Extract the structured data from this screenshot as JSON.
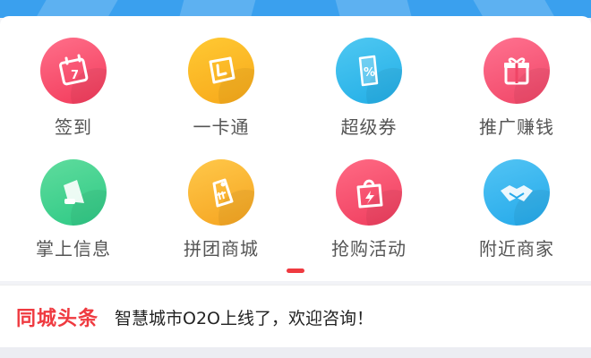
{
  "colors": {
    "accent_red": "#ef3a40",
    "banner_blue": "#3aa0ee"
  },
  "grid": {
    "items": [
      {
        "label": "签到",
        "icon": "calendar-icon",
        "color_top": "#ff6f8a",
        "color_bottom": "#f23a5a"
      },
      {
        "label": "一卡通",
        "icon": "card-icon",
        "color_top": "#ffc933",
        "color_bottom": "#f7a81a"
      },
      {
        "label": "超级券",
        "icon": "coupon-icon",
        "color_top": "#4fc8f2",
        "color_bottom": "#22aee6"
      },
      {
        "label": "推广赚钱",
        "icon": "gift-icon",
        "color_top": "#ff7290",
        "color_bottom": "#f04566"
      },
      {
        "label": "掌上信息",
        "icon": "megaphone-icon",
        "color_top": "#5fdc9d",
        "color_bottom": "#2ec985"
      },
      {
        "label": "拼团商城",
        "icon": "tag-icon",
        "color_top": "#ffc84a",
        "color_bottom": "#f5a420"
      },
      {
        "label": "抢购活动",
        "icon": "lightning-bag-icon",
        "color_top": "#ff6a84",
        "color_bottom": "#ef3d5e"
      },
      {
        "label": "附近商家",
        "icon": "handshake-icon",
        "color_top": "#52c4f4",
        "color_bottom": "#24a9ea"
      }
    ]
  },
  "news": {
    "label": "同城头条",
    "text": "智慧城市O2O上线了，欢迎咨询！"
  }
}
